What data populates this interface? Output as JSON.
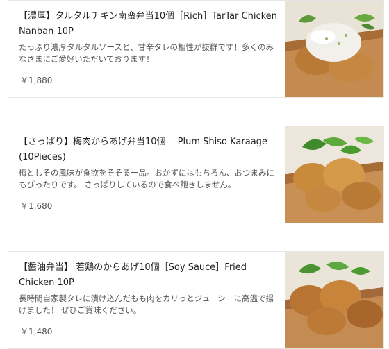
{
  "items": [
    {
      "title": "【濃厚】タルタルチキン南蛮弁当10個［Rich］TarTar Chicken Nanban 10P",
      "description": "たっぷり濃厚タルタルソースと、甘辛タレの相性が抜群です！多くのみなさまにご愛好いただいております！",
      "price": "￥1,880",
      "image_icon": "tartar-chicken-bento-photo"
    },
    {
      "title": "【さっぱり】梅肉からあげ弁当10個　 Plum Shiso Karaage (10Pieces)",
      "description": "梅としその風味が食欲をそそる一品。おかずにはもちろん、おつまみにもぴったりです。 さっぱりしているので食べ飽きしません。",
      "price": "￥1,680",
      "image_icon": "plum-karaage-bento-photo"
    },
    {
      "title": "【醤油弁当】 若鶏のからあげ10個［Soy Sauce］Fried Chicken 10P",
      "description": "長時間自家製タレに漬け込んだもも肉をカリっとジューシーに高温で揚げました！ ぜひご賞味ください。",
      "price": "￥1,480",
      "image_icon": "soy-karaage-bento-photo"
    }
  ]
}
